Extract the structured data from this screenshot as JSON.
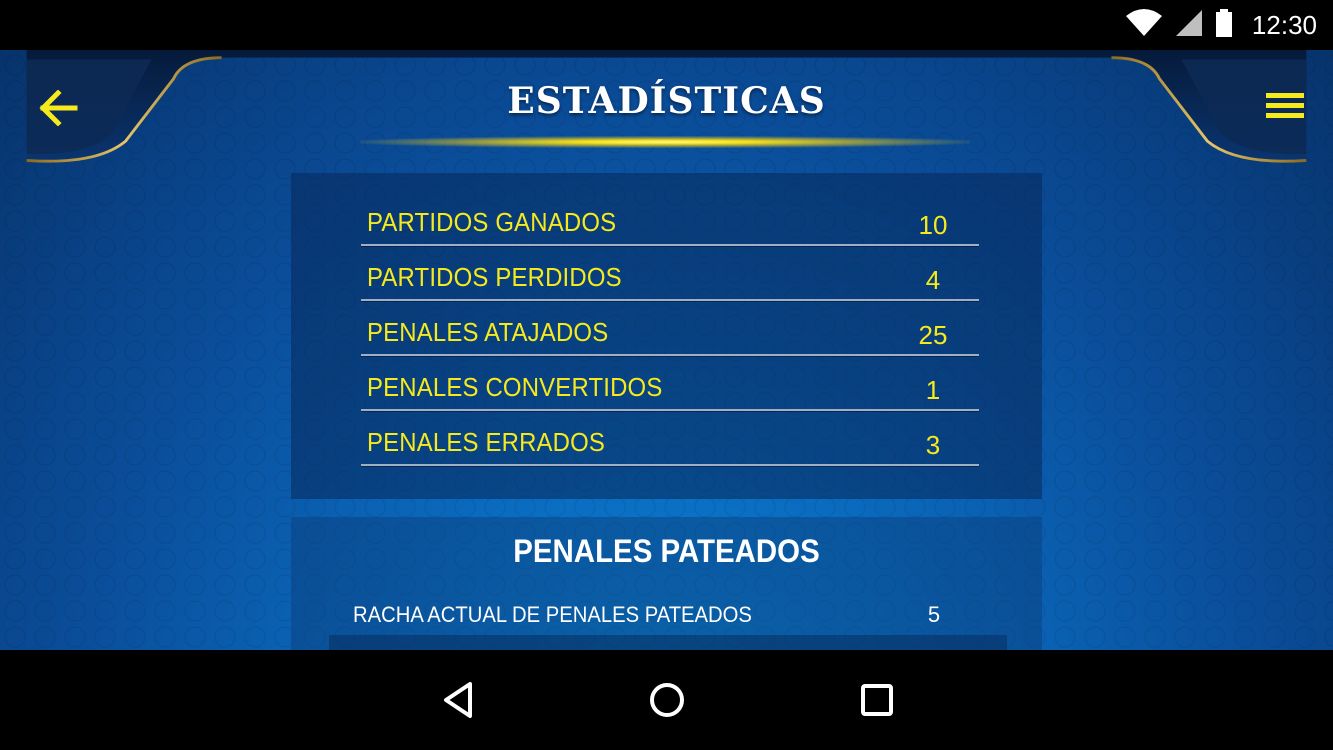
{
  "status_bar": {
    "time": "12:30",
    "icons": [
      "wifi-icon",
      "cell-signal-icon",
      "battery-icon"
    ]
  },
  "header": {
    "title": "ESTADÍSTICAS",
    "back_icon": "arrow-left-icon",
    "menu_icon": "hamburger-menu-icon"
  },
  "colors": {
    "accent_yellow": "#f7ea1c",
    "background_blue": "#0a4c98",
    "panel_dark": "#08285a",
    "text_white": "#ffffff"
  },
  "stats": {
    "rows": [
      {
        "label": "PARTIDOS GANADOS",
        "value": "10"
      },
      {
        "label": "PARTIDOS PERDIDOS",
        "value": "4"
      },
      {
        "label": "PENALES ATAJADOS",
        "value": "25"
      },
      {
        "label": "PENALES CONVERTIDOS",
        "value": "1"
      },
      {
        "label": "PENALES ERRADOS",
        "value": "3"
      }
    ]
  },
  "penales_pateados": {
    "title": "PENALES PATEADOS",
    "rows": [
      {
        "label": "RACHA ACTUAL DE PENALES PATEADOS",
        "value": "5"
      }
    ]
  },
  "nav_bar": {
    "icons": [
      "back-triangle-icon",
      "home-circle-icon",
      "recents-square-icon"
    ]
  }
}
